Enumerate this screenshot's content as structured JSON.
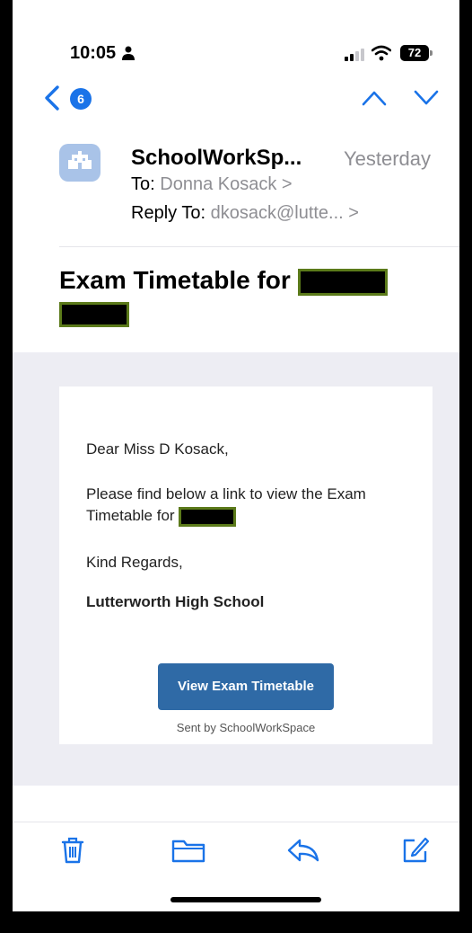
{
  "status_bar": {
    "time": "10:05",
    "battery": "72"
  },
  "nav": {
    "unread_count": "6"
  },
  "email": {
    "sender": "SchoolWorkSp...",
    "date": "Yesterday",
    "to_label": "To:",
    "to_value": "Donna Kosack >",
    "reply_label": "Reply To:",
    "reply_value": "dkosack@lutte... >",
    "subject": "Exam Timetable for"
  },
  "body": {
    "greeting": "Dear Miss D Kosack,",
    "message": "Please find below a link to view the Exam Timetable for",
    "regards": "Kind Regards,",
    "school": "Lutterworth High School",
    "button": "View Exam Timetable",
    "footer": "Sent by SchoolWorkSpace"
  },
  "colors": {
    "accent": "#1a73e8",
    "button": "#2f6aa6",
    "redaction_border": "#5b7a1a"
  }
}
